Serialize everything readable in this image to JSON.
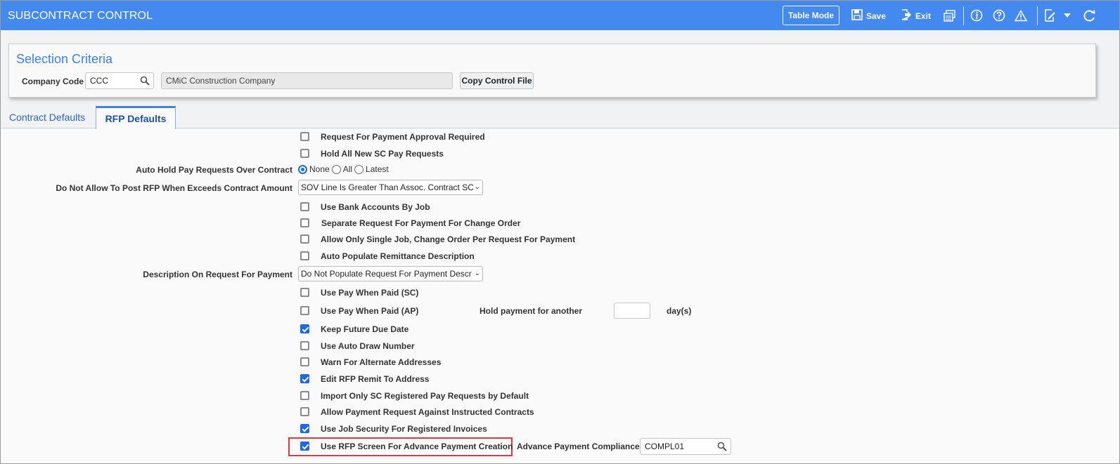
{
  "header": {
    "title": "SUBCONTRACT CONTROL",
    "table_mode_label": "Table Mode",
    "save_label": "Save",
    "exit_label": "Exit",
    "background_color": "#4489f0"
  },
  "selection_criteria": {
    "title": "Selection Criteria",
    "company_code_label": "Company Code",
    "company_code_value": "CCC",
    "company_name_value": "CMiC Construction Company",
    "copy_button_label": "Copy Control File"
  },
  "tabs": [
    {
      "label": "Contract Defaults",
      "active": false
    },
    {
      "label": "RFP Defaults",
      "active": true
    }
  ],
  "rfp_defaults": {
    "request_for_payment_approval_required": {
      "label": "Request For Payment Approval Required",
      "checked": false
    },
    "hold_all_new_sc_pay_requests": {
      "label": "Hold All New SC Pay Requests",
      "checked": false
    },
    "auto_hold": {
      "label": "Auto Hold Pay Requests Over Contract",
      "options": [
        "None",
        "All",
        "Latest"
      ],
      "selected": "None"
    },
    "do_not_allow_post": {
      "label": "Do Not Allow To Post RFP When Exceeds Contract Amount",
      "value": "SOV Line Is Greater Than Assoc. Contract SC"
    },
    "use_bank_accounts_by_job": {
      "label": "Use Bank Accounts By Job",
      "checked": false
    },
    "separate_rfp_change_order": {
      "label": "Separate Request For Payment For Change Order",
      "checked": false
    },
    "allow_only_single_job": {
      "label": "Allow Only Single Job, Change Order Per Request For Payment",
      "checked": false
    },
    "auto_populate_remittance": {
      "label": "Auto Populate Remittance Description",
      "checked": false
    },
    "description_on_rfp": {
      "label": "Description On Request For Payment",
      "value": "Do Not Populate Request For Payment Descr"
    },
    "use_pay_when_paid_sc": {
      "label": "Use Pay When Paid (SC)",
      "checked": false
    },
    "use_pay_when_paid_ap": {
      "label": "Use Pay When Paid (AP)",
      "checked": false
    },
    "hold_payment": {
      "label": "Hold payment for another",
      "value": "",
      "unit": "day(s)"
    },
    "keep_future_due_date": {
      "label": "Keep Future Due Date",
      "checked": true
    },
    "use_auto_draw_number": {
      "label": "Use Auto Draw Number",
      "checked": false
    },
    "warn_alternate_addresses": {
      "label": "Warn For Alternate Addresses",
      "checked": false
    },
    "edit_rfp_remit_to_address": {
      "label": "Edit RFP Remit To Address",
      "checked": true
    },
    "import_only_sc_registered": {
      "label": "Import Only SC Registered Pay Requests by Default",
      "checked": false
    },
    "allow_payment_instructed": {
      "label": "Allow Payment Request Against Instructed Contracts",
      "checked": false
    },
    "use_job_security": {
      "label": "Use Job Security For Registered Invoices",
      "checked": true
    },
    "use_rfp_screen_advance": {
      "label": "Use RFP Screen For Advance Payment Creation",
      "checked": true
    },
    "advance_payment_compliance": {
      "label": "Advance Payment Compliance",
      "value": "COMPL01"
    }
  }
}
